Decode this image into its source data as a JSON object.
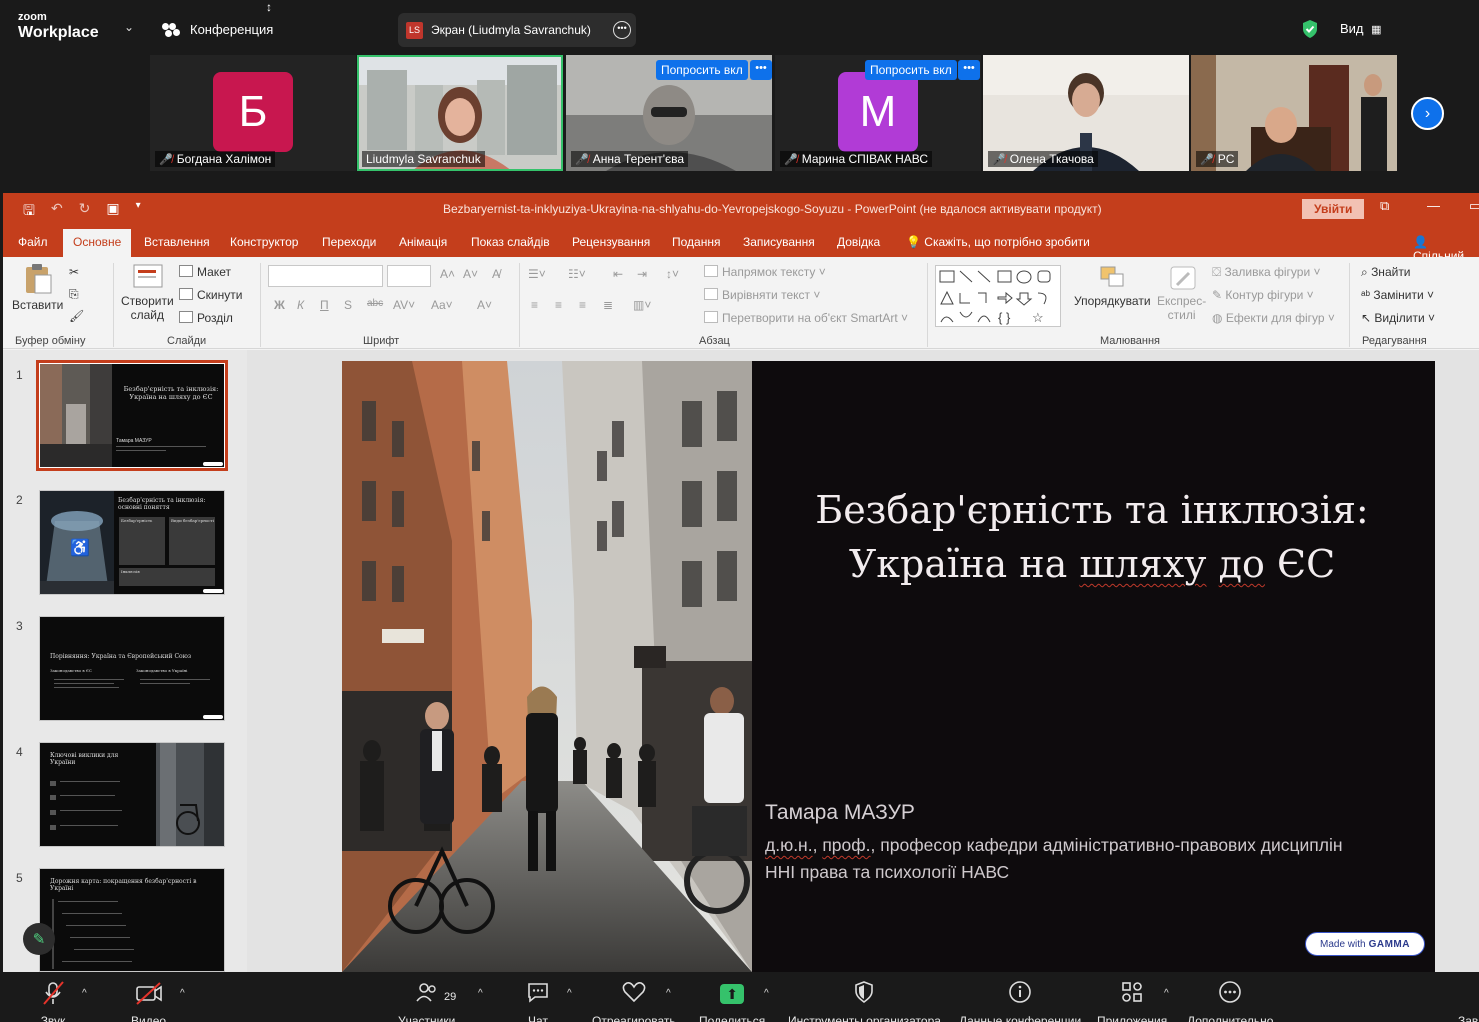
{
  "zoom": {
    "brand_small": "zoom",
    "brand_big": "Workplace",
    "conference_label": "Конференция",
    "screen_share_initials": "LS",
    "screen_share_label": "Экран (Liudmyla Savranchuk)",
    "view_label": "Вид"
  },
  "participants": [
    {
      "name": "Богдана Халімон",
      "initial": "Б",
      "color": "#c8174f",
      "muted": true
    },
    {
      "name": "Liudmyla Savranchuk",
      "active": true,
      "muted": false
    },
    {
      "name": "Анна Терент'єва",
      "muted": true,
      "ask_label": "Попросить вкл"
    },
    {
      "name": "Марина СПІВАК НАВС",
      "initial": "М",
      "color": "#b13bd6",
      "muted": true,
      "ask_label": "Попросить вкл"
    },
    {
      "name": "Олена Ткачова",
      "muted": true
    },
    {
      "name": "PC",
      "muted": true
    }
  ],
  "ppt": {
    "doc_title": "Bezbaryernist-ta-inklyuziya-Ukrayina-na-shlyahu-do-Yevropejskogo-Soyuzu  -  PowerPoint (не вдалося активувати продукт)",
    "signin": "Увійти",
    "tabs": [
      "Файл",
      "Основне",
      "Вставлення",
      "Конструктор",
      "Переходи",
      "Анімація",
      "Показ слайдів",
      "Рецензування",
      "Подання",
      "Записування",
      "Довідка"
    ],
    "tell_me": "Скажіть, що потрібно зробити",
    "share": "Спільний",
    "ribbon": {
      "paste": "Вставити",
      "clipboard": "Буфер обміну",
      "new_slide": "Створити\nслайд",
      "new_slide_1": "Створити",
      "new_slide_2": "слайд",
      "layout": "Макет",
      "reset": "Скинути",
      "section": "Розділ",
      "slides": "Слайди",
      "font": "Шрифт",
      "text_direction": "Напрямок тексту",
      "align_text": "Вирівняти текст",
      "smartart": "Перетворити на об'єкт SmartArt",
      "paragraph": "Абзац",
      "arrange": "Упорядкувати",
      "quick_styles_1": "Експрес-",
      "quick_styles_2": "стилі",
      "shape_fill": "Заливка фігури",
      "shape_outline": "Контур фігури",
      "shape_effects": "Ефекти для фігур",
      "drawing": "Малювання",
      "find": "Знайти",
      "replace": "Замінити",
      "select": "Виділити",
      "editing": "Редагування"
    }
  },
  "thumbnails": [
    {
      "num": "1",
      "title": "Безбар'єрність та інклюзія: Україна на шляху до ЄС",
      "sub": "Тамара МАЗУР"
    },
    {
      "num": "2",
      "title": "Безбар'єрність та інклюзія: основні поняття",
      "box1": "Безбар'єрність",
      "box2": "Види безбар'єрності",
      "box3": "Інклюзія"
    },
    {
      "num": "3",
      "title": "Порівняння: Україна та Європейський Союз",
      "col1": "Законодавство в ЄС",
      "col2": "Законодавство в Україні"
    },
    {
      "num": "4",
      "title": "Ключові виклики для України"
    },
    {
      "num": "5",
      "title": "Дорожня карта: покращення безбар'єрності в Україні"
    }
  ],
  "slide": {
    "title_line1": "Безбар'єрність та інклюзія:",
    "title_line2_a": "Україна на ",
    "title_line2_b": "шляху",
    "title_line2_c": " ",
    "title_line2_d": "до",
    "title_line2_e": " ЄС",
    "author": "Тамара  МАЗУР",
    "desc_a": "д.ю.н.",
    "desc_b": ", ",
    "desc_c": "проф.",
    "desc_d": ", професор кафедри адміністративно-правових дисциплін",
    "desc_line2": "ННІ права та психології НАВС",
    "gamma_made": "Made with",
    "gamma_brand": "GAMMA"
  },
  "toolbar": {
    "audio": "Звук",
    "video": "Видео",
    "participants": "Участники",
    "participants_count": "29",
    "chat": "Чат",
    "react": "Отреагировать",
    "share": "Поделиться",
    "host_tools": "Инструменты организатора",
    "meeting_info": "Данные конференции",
    "apps": "Приложения",
    "more": "Дополнительно",
    "end": "Зав"
  }
}
